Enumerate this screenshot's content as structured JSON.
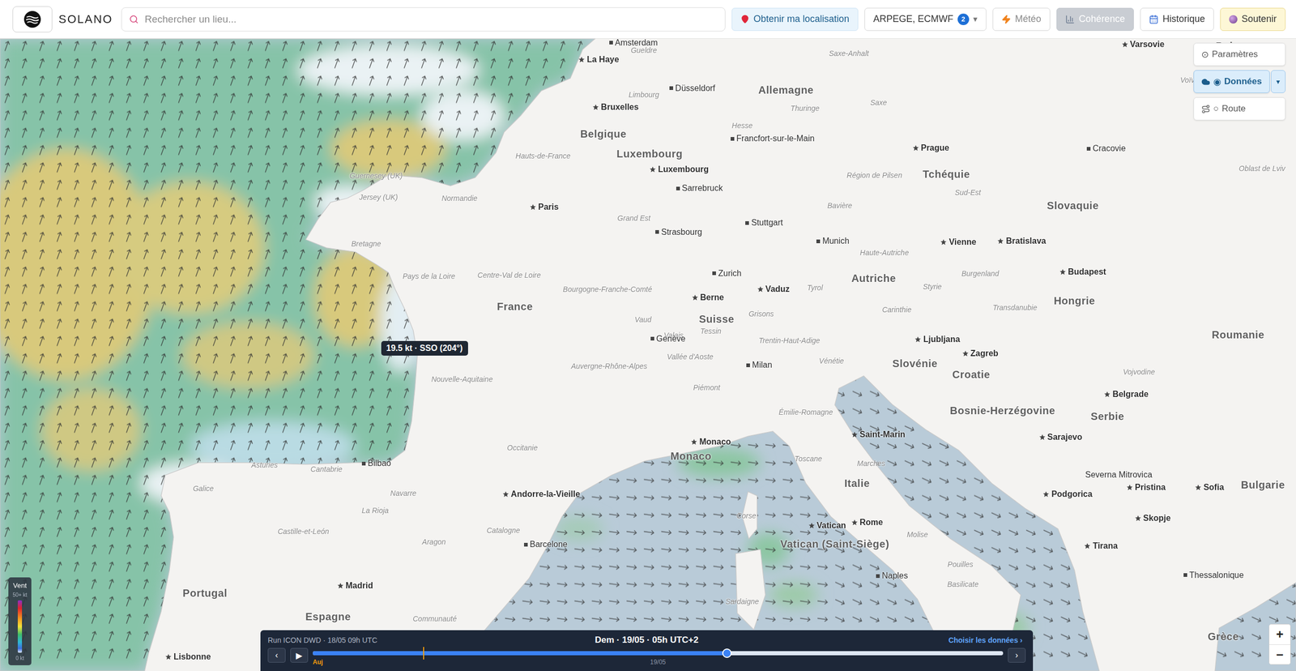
{
  "header": {
    "brand": "SOLANO",
    "search_placeholder": "Rechercher un lieu...",
    "location_button": "Obtenir ma localisation",
    "model_select": {
      "label": "ARPEGE, ECMWF",
      "count": "2",
      "caret": "▾"
    },
    "buttons": [
      {
        "label": "Météo",
        "kind": "dimmed"
      },
      {
        "label": "Cohérence",
        "kind": "filled"
      },
      {
        "label": "Historique",
        "kind": "plain"
      },
      {
        "label": "Soutenir",
        "kind": "support"
      }
    ]
  },
  "layer_panel": [
    {
      "glyph": "⊙",
      "label": "Paramètres",
      "selected": false
    },
    {
      "glyph": "◉",
      "label": "Données",
      "selected": true,
      "caret": "▾"
    },
    {
      "glyph": "○",
      "label": "Route",
      "selected": false
    }
  ],
  "map": {
    "countries": [
      "Allemagne",
      "Belgique",
      "Luxembourg",
      "France",
      "Suisse",
      "Autriche",
      "Tchéquie",
      "Slovaquie",
      "Hongrie",
      "Roumanie",
      "Slovénie",
      "Croatie",
      "Bosnie-Herzégovine",
      "Serbie",
      "Italie",
      "Monaco",
      "Espagne",
      "Portugal",
      "Bulgarie",
      "Grèce",
      "Pologne",
      "Vatican (Saint-Siège)"
    ],
    "cities": [
      {
        "label": "Amsterdam",
        "kind": "city"
      },
      {
        "label": "La Haye",
        "kind": "capital"
      },
      {
        "label": "Bruxelles",
        "kind": "capital"
      },
      {
        "label": "Düsseldorf",
        "kind": "city"
      },
      {
        "label": "Luxembourg",
        "kind": "capital"
      },
      {
        "label": "Francfort-sur-le-Main",
        "kind": "city"
      },
      {
        "label": "Sarrebruck",
        "kind": "city"
      },
      {
        "label": "Prague",
        "kind": "capital"
      },
      {
        "label": "Cracovie",
        "kind": "city"
      },
      {
        "label": "Paris",
        "kind": "capital"
      },
      {
        "label": "Strasbourg",
        "kind": "city"
      },
      {
        "label": "Stuttgart",
        "kind": "city"
      },
      {
        "label": "Munich",
        "kind": "city"
      },
      {
        "label": "Vienne",
        "kind": "capital"
      },
      {
        "label": "Bratislava",
        "kind": "capital"
      },
      {
        "label": "Budapest",
        "kind": "capital"
      },
      {
        "label": "Zurich",
        "kind": "city"
      },
      {
        "label": "Vaduz",
        "kind": "capital"
      },
      {
        "label": "Berne",
        "kind": "capital"
      },
      {
        "label": "Genève",
        "kind": "city"
      },
      {
        "label": "Ljubljana",
        "kind": "capital"
      },
      {
        "label": "Zagreb",
        "kind": "capital"
      },
      {
        "label": "Milan",
        "kind": "city"
      },
      {
        "label": "Belgrade",
        "kind": "capital"
      },
      {
        "label": "Sarajevo",
        "kind": "capital"
      },
      {
        "label": "Saint-Marin",
        "kind": "capital"
      },
      {
        "label": "Monaco",
        "kind": "capital"
      },
      {
        "label": "Andorre-la-Vieille",
        "kind": "capital"
      },
      {
        "label": "Bilbao",
        "kind": "city"
      },
      {
        "label": "Barcelone",
        "kind": "city"
      },
      {
        "label": "Madrid",
        "kind": "capital"
      },
      {
        "label": "Vatican",
        "kind": "capital"
      },
      {
        "label": "Rome",
        "kind": "capital"
      },
      {
        "label": "Naples",
        "kind": "city"
      },
      {
        "label": "Podgorica",
        "kind": "capital"
      },
      {
        "label": "Severna Mitrovica",
        "kind": "town"
      },
      {
        "label": "Pristina",
        "kind": "capital"
      },
      {
        "label": "Skopje",
        "kind": "capital"
      },
      {
        "label": "Sofia",
        "kind": "capital"
      },
      {
        "label": "Tirana",
        "kind": "capital"
      },
      {
        "label": "Thessalonique",
        "kind": "city"
      },
      {
        "label": "Lisbonne",
        "kind": "capital"
      },
      {
        "label": "Varsovie",
        "kind": "capital"
      }
    ],
    "regions": [
      "Saxe-Anhalt",
      "Gueldre",
      "Limbourg",
      "Hesse",
      "Thuringe",
      "Saxe",
      "Hauts-de-France",
      "Normandie",
      "Bretagne",
      "Pays de la Loire",
      "Centre-Val de Loire",
      "Grand Est",
      "Bavière",
      "Région de Pilsen",
      "Bourgogne-Franche-Comté",
      "Haute-Autriche",
      "Sud-Est",
      "Burgenland",
      "Styrie",
      "Carinthie",
      "Tyrol",
      "Vaud",
      "Valais",
      "Tessin",
      "Grisons",
      "Auvergne-Rhône-Alpes",
      "Nouvelle-Aquitaine",
      "Vallée d'Aoste",
      "Trentin-Haut-Adige",
      "Vénétie",
      "Piémont",
      "Émilie-Romagne",
      "Toscane",
      "Marches",
      "Corse",
      "Sardaigne",
      "Molise",
      "Pouilles",
      "Basilicate",
      "Occitanie",
      "Galice",
      "Asturies",
      "Cantabrie",
      "Navarre",
      "La Rioja",
      "Aragon",
      "Catalogne",
      "Castille-et-León",
      "Guernesey (UK)",
      "Jersey (UK)",
      "Voïvodie de Łódź",
      "Oblast de Lviv",
      "Transdanubie",
      "Vojvodine",
      "Communauté"
    ]
  },
  "tooltip": "19.5 kt · SSO (204°)",
  "legend": {
    "title": "Vent",
    "max": "50+ kt",
    "min": "0 kt"
  },
  "timeline": {
    "run": "Run ICON DWD · 18/05 09h UTC",
    "current": "Dem · 19/05 · 05h UTC+2",
    "choose": "Choisir les données ›",
    "prev": "‹",
    "play": "▶",
    "next": "›",
    "now_label": "Auj",
    "now_level": 0.16,
    "level": 0.6,
    "ticks": [
      {
        "label": "19/05",
        "level": 0.5
      }
    ]
  },
  "zoom": [
    "+",
    "−"
  ]
}
